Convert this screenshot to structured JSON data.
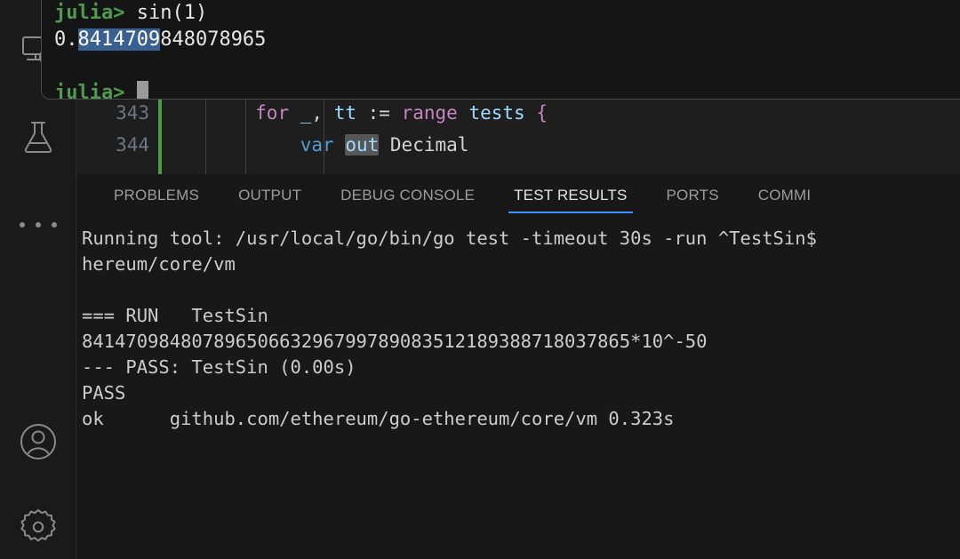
{
  "theme": {
    "editor_bg": "#1e1e1e",
    "panel_bg": "#181818",
    "activity_bg": "#1a1a1a",
    "accent_blue": "#3794ff",
    "prompt_green": "#4e9a4e",
    "selection_blue": "#3a5f91",
    "git_modified_green": "#4a9c4a"
  },
  "activity_bar": {
    "items": [
      {
        "name": "remote-explorer-icon",
        "label": "Remote Explorer"
      },
      {
        "name": "testing-flask-icon",
        "label": "Testing"
      },
      {
        "name": "more-actions-icon",
        "label": "Additional Views"
      },
      {
        "name": "accounts-icon",
        "label": "Accounts"
      },
      {
        "name": "settings-gear-icon",
        "label": "Manage"
      }
    ]
  },
  "repl": {
    "prompt": "julia>",
    "input": " sin(1)",
    "result_prefix": "0.",
    "result_selected": "8414709",
    "result_rest": "848078965",
    "prompt2": "julia>"
  },
  "editor": {
    "lines": [
      {
        "number": "343",
        "tokens": [
          {
            "text": "        ",
            "cls": "tk-plain"
          },
          {
            "text": "for",
            "cls": "tk-kw"
          },
          {
            "text": " ",
            "cls": "tk-plain"
          },
          {
            "text": "_",
            "cls": "tk-ident"
          },
          {
            "text": ", ",
            "cls": "tk-plain"
          },
          {
            "text": "tt",
            "cls": "tk-ident"
          },
          {
            "text": " := ",
            "cls": "tk-plain"
          },
          {
            "text": "range",
            "cls": "tk-kw"
          },
          {
            "text": " ",
            "cls": "tk-plain"
          },
          {
            "text": "tests",
            "cls": "tk-ident"
          },
          {
            "text": " ",
            "cls": "tk-plain"
          },
          {
            "text": "{",
            "cls": "tk-brace"
          }
        ]
      },
      {
        "number": "344",
        "tokens": [
          {
            "text": "            ",
            "cls": "tk-plain"
          },
          {
            "text": "var",
            "cls": "tk-var"
          },
          {
            "text": " ",
            "cls": "tk-plain"
          },
          {
            "text": "out",
            "cls": "tk-ident word-hl"
          },
          {
            "text": " ",
            "cls": "tk-plain"
          },
          {
            "text": "Decimal",
            "cls": "tk-type"
          }
        ]
      }
    ]
  },
  "panel": {
    "tabs": [
      {
        "label": "PROBLEMS",
        "active": false
      },
      {
        "label": "OUTPUT",
        "active": false
      },
      {
        "label": "DEBUG CONSOLE",
        "active": false
      },
      {
        "label": "TEST RESULTS",
        "active": true
      },
      {
        "label": "PORTS",
        "active": false
      },
      {
        "label": "COMMI",
        "active": false
      }
    ],
    "output_lines": [
      "Running tool: /usr/local/go/bin/go test -timeout 30s -run ^TestSin$",
      "hereum/core/vm",
      "",
      "=== RUN   TestSin",
      "84147098480789650663296799789083512189388718037865*10^-50",
      "--- PASS: TestSin (0.00s)",
      "PASS",
      "ok      github.com/ethereum/go-ethereum/core/vm 0.323s"
    ]
  }
}
